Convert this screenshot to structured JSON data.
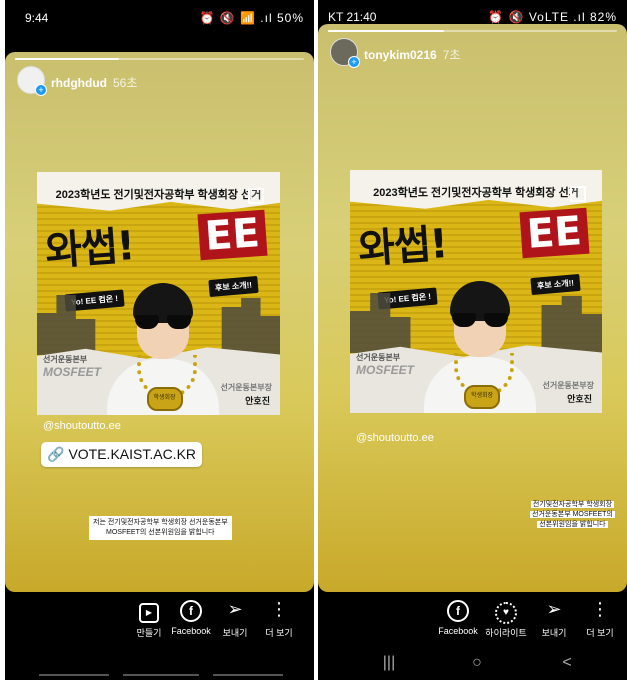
{
  "left": {
    "status": {
      "time": "9:44",
      "icons": "⏰ 🔇 📶 .ıl",
      "battery": "50%"
    },
    "progress": 0.36,
    "user": {
      "name": "rhdghdud",
      "time_ago": "56초"
    },
    "poster": {
      "title": "2023학년도 전기및전자공학부 학생회장 선거",
      "big": "와썹!",
      "ee": "EE",
      "pill_1": "Yo! EE 컴온 !",
      "pill_2": "후보 소개!!",
      "party": "선거운동본부",
      "party_name": "MOSFEET",
      "role": "선거운동본부장",
      "person_name": "안호진",
      "medal": "학생회장"
    },
    "mention": "@shoutoutto.ee",
    "link": "VOTE.KAIST.AC.KR",
    "caption_lines": [
      "저는  전기및전자공학부  학생회장  선거운동본부",
      "MOSFEET의  선본위원임을  밝힙니다"
    ],
    "actions": [
      {
        "icon": "make-icon",
        "label": "만들기"
      },
      {
        "icon": "facebook-icon",
        "label": "Facebook"
      },
      {
        "icon": "send-icon",
        "label": "보내기"
      },
      {
        "icon": "more-icon",
        "label": "더 보기"
      }
    ]
  },
  "right": {
    "status": {
      "time": "KT 21:40",
      "icons": "⏰ 🔇 VoLTE .ıl",
      "battery": "82%"
    },
    "progress": 0.4,
    "user": {
      "name": "tonykim0216",
      "time_ago": "7초"
    },
    "mention": "@shoutoutto.ee",
    "caption_lines": [
      "전기및전자공학부 학생회장",
      "선거운동본부 MOSFEET의",
      "선본위원임을 밝힙니다"
    ],
    "actions": [
      {
        "icon": "facebook-icon",
        "label": "Facebook"
      },
      {
        "icon": "highlight-icon",
        "label": "하이라이트"
      },
      {
        "icon": "send-icon",
        "label": "보내기"
      },
      {
        "icon": "more-icon",
        "label": "더 보기"
      }
    ],
    "nav": {
      "recents": "|||",
      "home": "○",
      "back": "<"
    }
  }
}
